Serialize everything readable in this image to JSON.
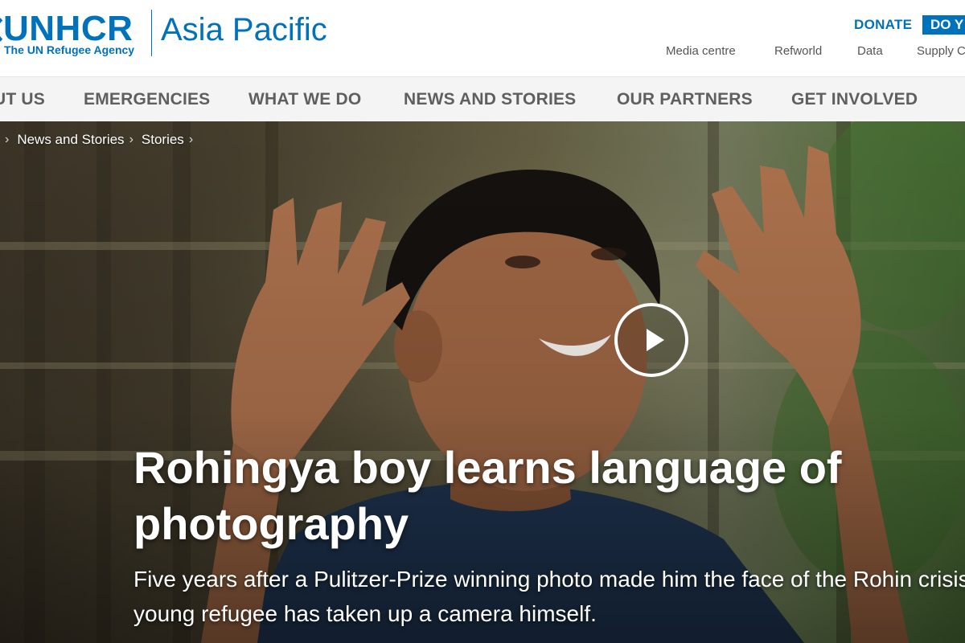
{
  "header": {
    "logo_wordmark": "UNHCR",
    "logo_tagline": "The UN Refugee Agency",
    "region": "Asia Pacific",
    "donate_label": "DONATE",
    "cta_label": "DO Y",
    "utility_links": [
      "Media centre",
      "Refworld",
      "Data",
      "Supply C"
    ],
    "brand_color": "#0072bc"
  },
  "nav": {
    "items": [
      "UT US",
      "EMERGENCIES",
      "WHAT WE DO",
      "NEWS AND STORIES",
      "OUR PARTNERS",
      "GET INVOLVED"
    ]
  },
  "breadcrumb": [
    "News and Stories",
    "Stories"
  ],
  "hero": {
    "headline": "Rohingya boy learns language of photography",
    "dek": "Five years after a Pulitzer-Prize winning photo made him the face of the Rohin crisis, a young refugee has taken up a camera himself.",
    "play_icon": "play-icon"
  }
}
